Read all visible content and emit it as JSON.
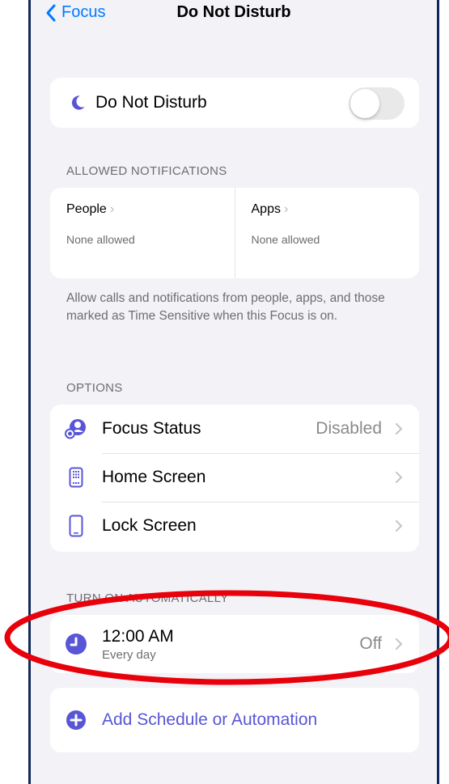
{
  "nav": {
    "back_label": "Focus",
    "title": "Do Not Disturb"
  },
  "toggle": {
    "label": "Do Not Disturb",
    "on": false,
    "icon": "moon-icon"
  },
  "allowed": {
    "header": "ALLOWED NOTIFICATIONS",
    "people": {
      "label": "People",
      "value": "None allowed"
    },
    "apps": {
      "label": "Apps",
      "value": "None allowed"
    },
    "footnote": "Allow calls and notifications from people, apps, and those marked as Time Sensitive when this Focus is on."
  },
  "options": {
    "header": "OPTIONS",
    "items": [
      {
        "label": "Focus Status",
        "value": "Disabled",
        "icon": "focus-status-icon"
      },
      {
        "label": "Home Screen",
        "value": "",
        "icon": "home-screen-icon"
      },
      {
        "label": "Lock Screen",
        "value": "",
        "icon": "lock-screen-icon"
      }
    ]
  },
  "automation": {
    "header": "TURN ON AUTOMATICALLY",
    "schedule": {
      "time": "12:00 AM",
      "frequency": "Every day",
      "state": "Off"
    },
    "add_label": "Add Schedule or Automation"
  },
  "colors": {
    "accent": "#007aff",
    "purple": "#5856d6",
    "annotation": "#e8000b"
  }
}
